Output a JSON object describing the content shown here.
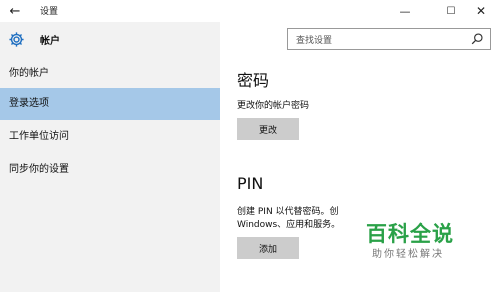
{
  "window": {
    "title": "设置",
    "back_glyph": "←",
    "min_glyph": "—",
    "max_glyph": "☐",
    "close_glyph": "✕"
  },
  "sidebar": {
    "header": "帐户",
    "items": [
      {
        "label": "你的帐户",
        "active": false
      },
      {
        "label": "登录选项",
        "active": true
      },
      {
        "label": "工作单位访问",
        "active": false
      },
      {
        "label": "同步你的设置",
        "active": false
      }
    ]
  },
  "search": {
    "placeholder": "查找设置"
  },
  "main": {
    "password": {
      "title": "密码",
      "desc": "更改你的帐户密码",
      "button": "更改"
    },
    "pin": {
      "title": "PIN",
      "desc_line1": "创建 PIN 以代替密码。创",
      "desc_line2": "Windows、应用和服务。",
      "button": "添加"
    }
  },
  "watermark": {
    "logo": "百科全说",
    "sub": "助你轻松解决"
  },
  "colors": {
    "sidebar_bg": "#f2f2f2",
    "active_bg": "#a5c8e8",
    "button_bg": "#cccccc",
    "accent": "#1f6fc1",
    "watermark_green": "#2aa148"
  },
  "icons": {
    "back": "back-arrow-icon",
    "gear": "gear-icon",
    "search": "search-icon"
  }
}
